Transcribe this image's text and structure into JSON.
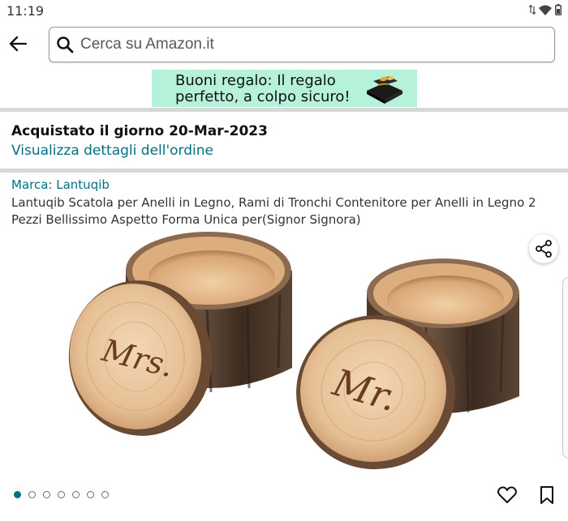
{
  "status_bar": {
    "time": "11:19"
  },
  "search": {
    "placeholder": "Cerca su Amazon.it"
  },
  "banner": {
    "line1": "Buoni regalo: Il regalo",
    "line2": "perfetto, a colpo sicuro!"
  },
  "order": {
    "date_text": "Acquistato il giorno 20-Mar-2023",
    "details_link": "Visualizza dettagli dell'ordine"
  },
  "product": {
    "brand": "Marca: Lantuqib",
    "title": "Lantuqib Scatola per Anelli in Legno, Rami di Tronchi Contenitore per Anelli in Legno 2 Pezzi Bellissimo Aspetto Forma Unica per(Signor Signora)",
    "image_label_left": "Mrs.",
    "image_label_right": "Mr."
  },
  "carousel": {
    "count": 7,
    "active_index": 0
  },
  "colors": {
    "link": "#007185",
    "banner_bg": "#b6f2d9",
    "divider": "#d5d9d9"
  }
}
